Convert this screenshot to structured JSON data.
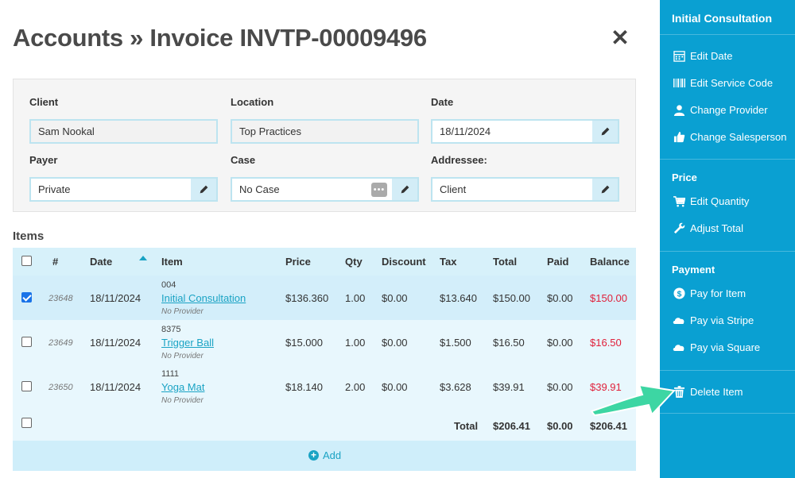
{
  "page": {
    "title": "Accounts » Invoice INVTP-00009496",
    "close_glyph": "✕"
  },
  "form": {
    "client": {
      "label": "Client",
      "value": "Sam Nookal"
    },
    "location": {
      "label": "Location",
      "value": "Top Practices"
    },
    "date": {
      "label": "Date",
      "value": "18/11/2024"
    },
    "payer": {
      "label": "Payer",
      "value": "Private"
    },
    "case": {
      "label": "Case",
      "value": "No Case"
    },
    "addressee": {
      "label": "Addressee:",
      "value": "Client"
    }
  },
  "items": {
    "heading": "Items",
    "columns": {
      "num": "#",
      "date": "Date",
      "item": "Item",
      "price": "Price",
      "qty": "Qty",
      "discount": "Discount",
      "tax": "Tax",
      "total": "Total",
      "paid": "Paid",
      "balance": "Balance"
    },
    "rows": [
      {
        "checked": true,
        "id": "23648",
        "date": "18/11/2024",
        "code": "004",
        "name": "Initial Consultation",
        "provider": "No Provider",
        "price": "$136.360",
        "qty": "1.00",
        "discount": "$0.00",
        "tax": "$13.640",
        "total": "$150.00",
        "paid": "$0.00",
        "balance": "$150.00"
      },
      {
        "checked": false,
        "id": "23649",
        "date": "18/11/2024",
        "code": "8375",
        "name": "Trigger Ball",
        "provider": "No Provider",
        "price": "$15.000",
        "qty": "1.00",
        "discount": "$0.00",
        "tax": "$1.500",
        "total": "$16.50",
        "paid": "$0.00",
        "balance": "$16.50"
      },
      {
        "checked": false,
        "id": "23650",
        "date": "18/11/2024",
        "code": "1111",
        "name": "Yoga Mat",
        "provider": "No Provider",
        "price": "$18.140",
        "qty": "2.00",
        "discount": "$0.00",
        "tax": "$3.628",
        "total": "$39.91",
        "paid": "$0.00",
        "balance": "$39.91"
      }
    ],
    "totals": {
      "label": "Total",
      "total": "$206.41",
      "paid": "$0.00",
      "balance": "$206.41"
    },
    "add_label": "Add"
  },
  "sidebar": {
    "title": "Initial Consultation",
    "group1": [
      {
        "label": "Edit Date",
        "icon": "calendar-icon"
      },
      {
        "label": "Edit Service Code",
        "icon": "barcode-icon"
      },
      {
        "label": "Change Provider",
        "icon": "user-icon"
      },
      {
        "label": "Change Salesperson",
        "icon": "thumbs-up-icon"
      }
    ],
    "price_heading": "Price",
    "price_items": [
      {
        "label": "Edit Quantity",
        "icon": "cart-icon"
      },
      {
        "label": "Adjust Total",
        "icon": "wrench-icon"
      }
    ],
    "payment_heading": "Payment",
    "payment_items": [
      {
        "label": "Pay for Item",
        "icon": "dollar-icon"
      },
      {
        "label": "Pay via Stripe",
        "icon": "cloud-icon"
      },
      {
        "label": "Pay via Square",
        "icon": "cloud-icon"
      }
    ],
    "delete_label": "Delete Item"
  },
  "colors": {
    "sidebar": "#0aa0d2",
    "link": "#1aa3c4",
    "balance_due": "#e0203a",
    "highlight_arrow": "#3dd6a3"
  }
}
